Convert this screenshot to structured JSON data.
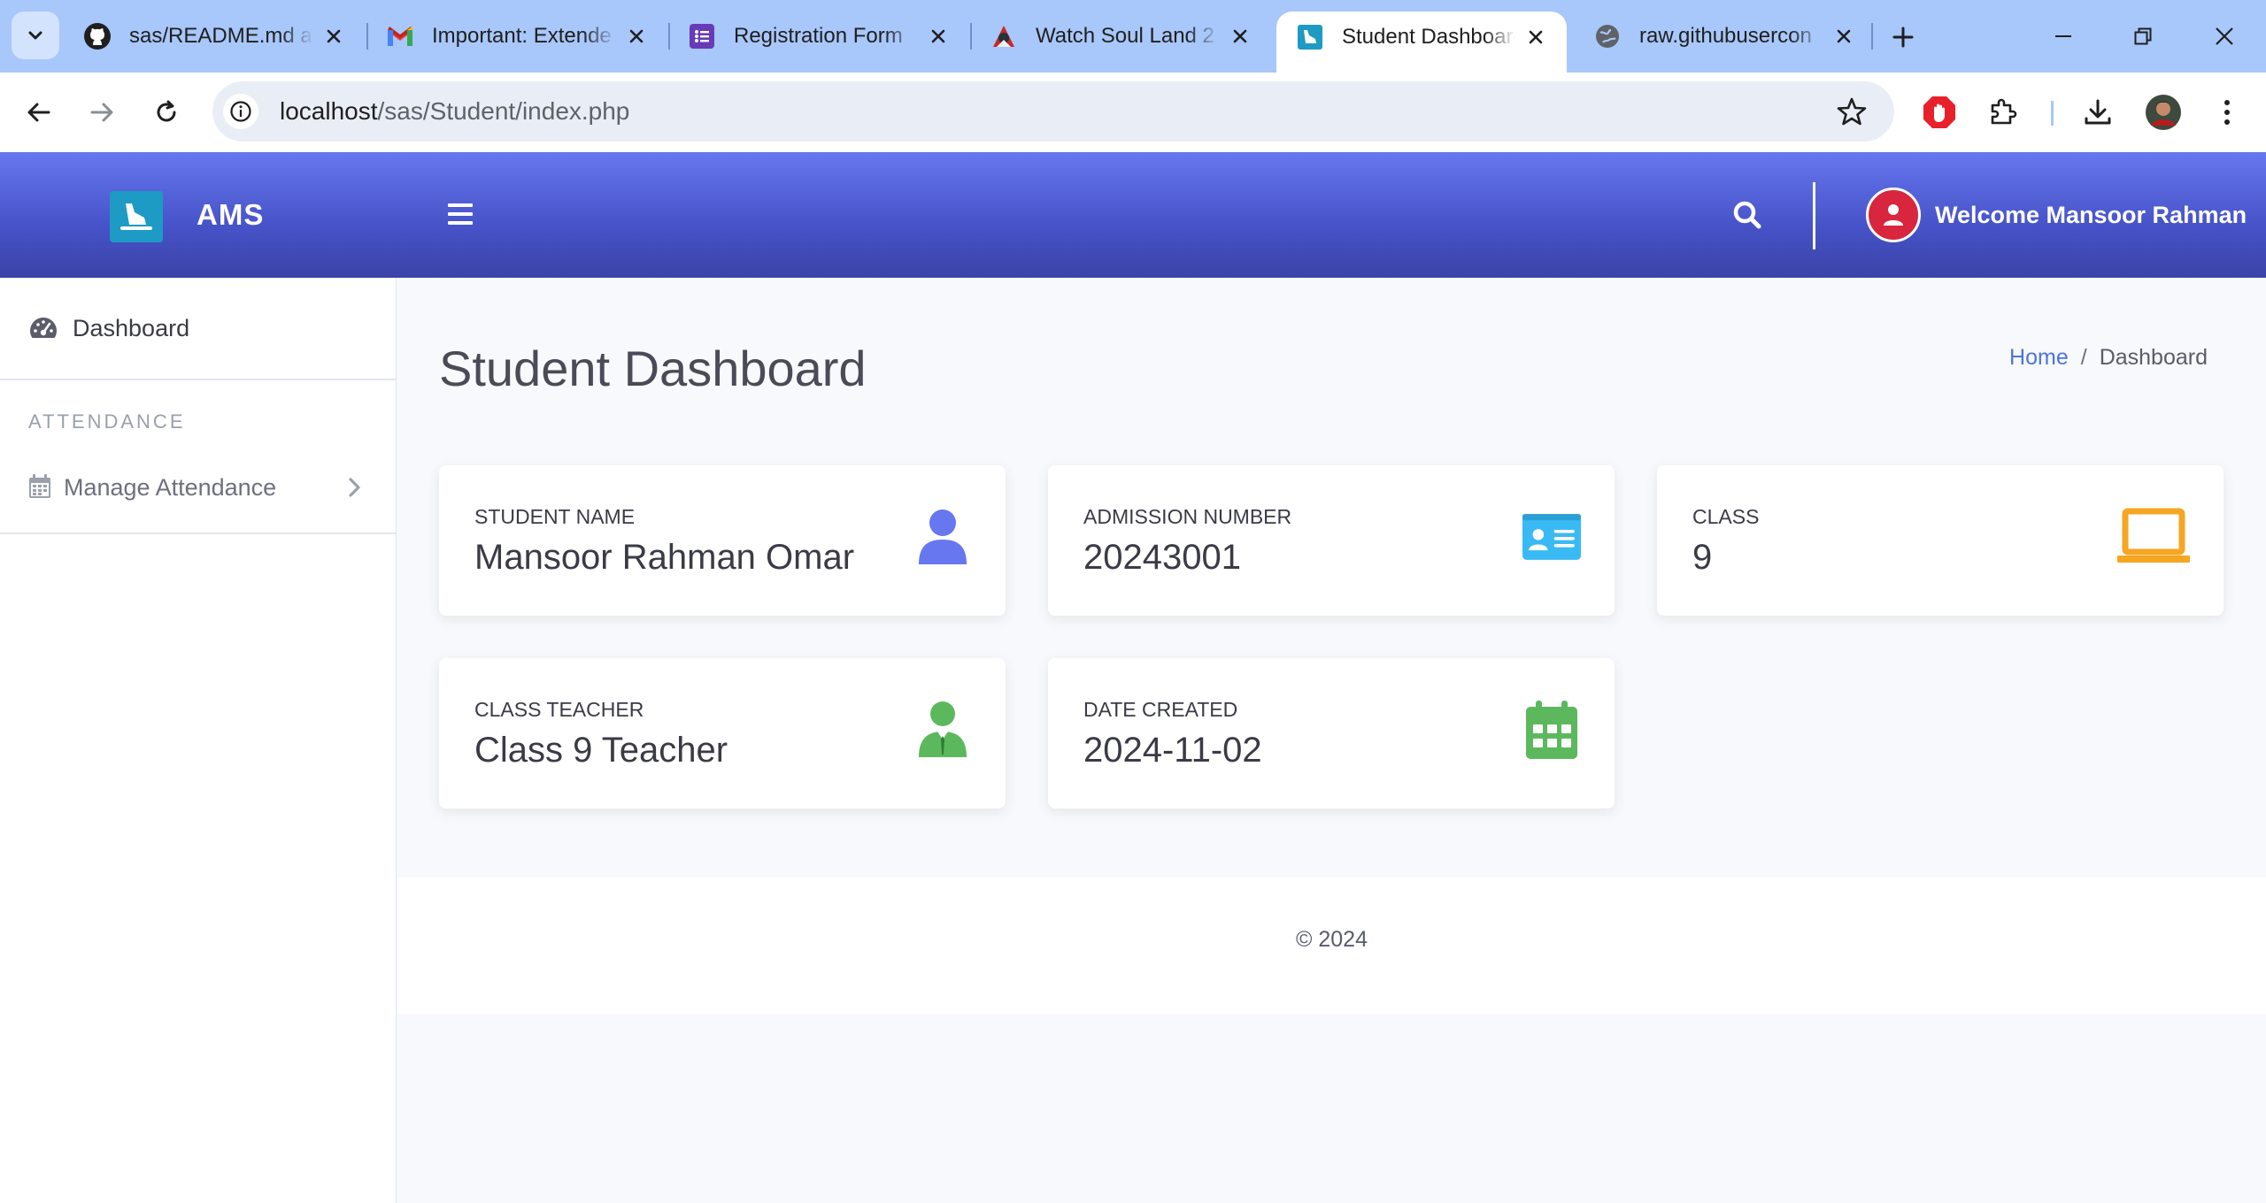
{
  "browser": {
    "tabs": [
      {
        "title": "sas/README.md at",
        "favicon": "github-icon"
      },
      {
        "title": "Important: Extende",
        "favicon": "gmail-icon"
      },
      {
        "title": "Registration Form",
        "favicon": "forms-icon"
      },
      {
        "title": "Watch Soul Land 2",
        "favicon": "anime-icon"
      },
      {
        "title": "Student Dashboard",
        "favicon": "ams-icon",
        "active": true
      },
      {
        "title": "raw.githubusercon",
        "favicon": "globe-icon"
      }
    ],
    "url_host": "localhost",
    "url_path": "/sas/Student/index.php"
  },
  "app": {
    "brand": "AMS",
    "welcome": "Welcome Mansoor Rahman"
  },
  "sidebar": {
    "dashboard_label": "Dashboard",
    "section_heading": "ATTENDANCE",
    "manage_attendance_label": "Manage Attendance"
  },
  "main": {
    "page_title": "Student Dashboard",
    "breadcrumb": {
      "home": "Home",
      "separator": "/",
      "current": "Dashboard"
    },
    "cards": [
      {
        "label": "STUDENT NAME",
        "value": "Mansoor Rahman Omar",
        "icon": "user-icon",
        "color": "#6777ef"
      },
      {
        "label": "ADMISSION NUMBER",
        "value": "20243001",
        "icon": "id-card-icon",
        "color": "#3abaf4"
      },
      {
        "label": "CLASS",
        "value": "9",
        "icon": "laptop-icon",
        "color": "#f6a623"
      },
      {
        "label": "CLASS TEACHER",
        "value": "Class 9 Teacher",
        "icon": "teacher-icon",
        "color": "#5cb85c"
      },
      {
        "label": "DATE CREATED",
        "value": "2024-11-02",
        "icon": "calendar-icon",
        "color": "#5cb85c"
      }
    ],
    "footer": "© 2024"
  }
}
